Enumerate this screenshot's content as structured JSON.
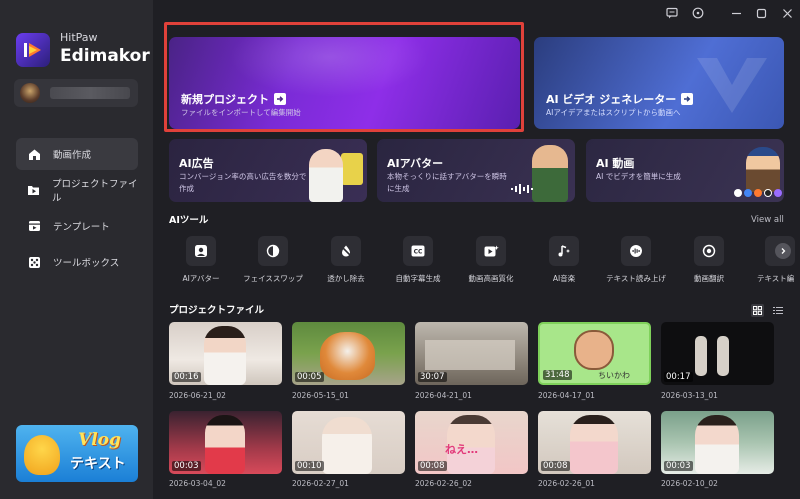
{
  "app": {
    "brand": "HitPaw",
    "name": "Edimakor"
  },
  "sidebar": {
    "items": [
      {
        "label": "動画作成",
        "active": true
      },
      {
        "label": "プロジェクトファイル"
      },
      {
        "label": "テンプレート"
      },
      {
        "label": "ツールボックス"
      }
    ],
    "promo": {
      "title": "Vlog",
      "subtitle": "テキスト"
    }
  },
  "hero": {
    "new_project": {
      "title": "新規プロジェクト",
      "subtitle": "ファイルをインポートして編集開始"
    },
    "ai_video": {
      "title": "AI ビデオ ジェネレーター",
      "subtitle": "AIアイデアまたはスクリプトから動画へ"
    }
  },
  "features": [
    {
      "title": "AI広告",
      "subtitle": "コンバージョン率の高い広告を数分で作成"
    },
    {
      "title": "AIアバター",
      "subtitle": "本物そっくりに話すアバターを瞬時に生成"
    },
    {
      "title": "AI 動画",
      "subtitle": "AI でビデオを簡単に生成"
    }
  ],
  "ai_tools": {
    "heading": "AIツール",
    "view_all": "View all",
    "items": [
      {
        "label": "AIアバター",
        "icon": "avatar-icon"
      },
      {
        "label": "フェイススワップ",
        "icon": "face-swap-icon"
      },
      {
        "label": "透かし除去",
        "icon": "watermark-remove-icon"
      },
      {
        "label": "自動字幕生成",
        "icon": "subtitle-icon"
      },
      {
        "label": "動画高画質化",
        "icon": "enhance-icon"
      },
      {
        "label": "AI音楽",
        "icon": "music-icon"
      },
      {
        "label": "テキスト読み上げ",
        "icon": "tts-icon"
      },
      {
        "label": "動画翻訳",
        "icon": "translate-icon"
      },
      {
        "label": "テキスト編",
        "icon": "text-edit-icon"
      }
    ]
  },
  "projects": {
    "heading": "プロジェクトファイル",
    "items": [
      {
        "name": "2026-06-21_02",
        "duration": "00:16"
      },
      {
        "name": "2026-05-15_01",
        "duration": "00:05"
      },
      {
        "name": "2026-04-21_01",
        "duration": "30:07"
      },
      {
        "name": "2026-04-17_01",
        "duration": "31:48"
      },
      {
        "name": "2026-03-13_01",
        "duration": "00:17"
      },
      {
        "name": "2026-03-04_02",
        "duration": "00:03"
      },
      {
        "name": "2026-02-27_01",
        "duration": "00:10"
      },
      {
        "name": "2026-02-26_02",
        "duration": "00:08"
      },
      {
        "name": "2026-02-26_01",
        "duration": "00:08"
      },
      {
        "name": "2026-02-10_02",
        "duration": "00:03"
      }
    ]
  },
  "colors": {
    "accent": "#7a2bd6",
    "highlight": "#e0413a",
    "background": "#1f1f24",
    "sidebar": "#2a2a2f"
  }
}
